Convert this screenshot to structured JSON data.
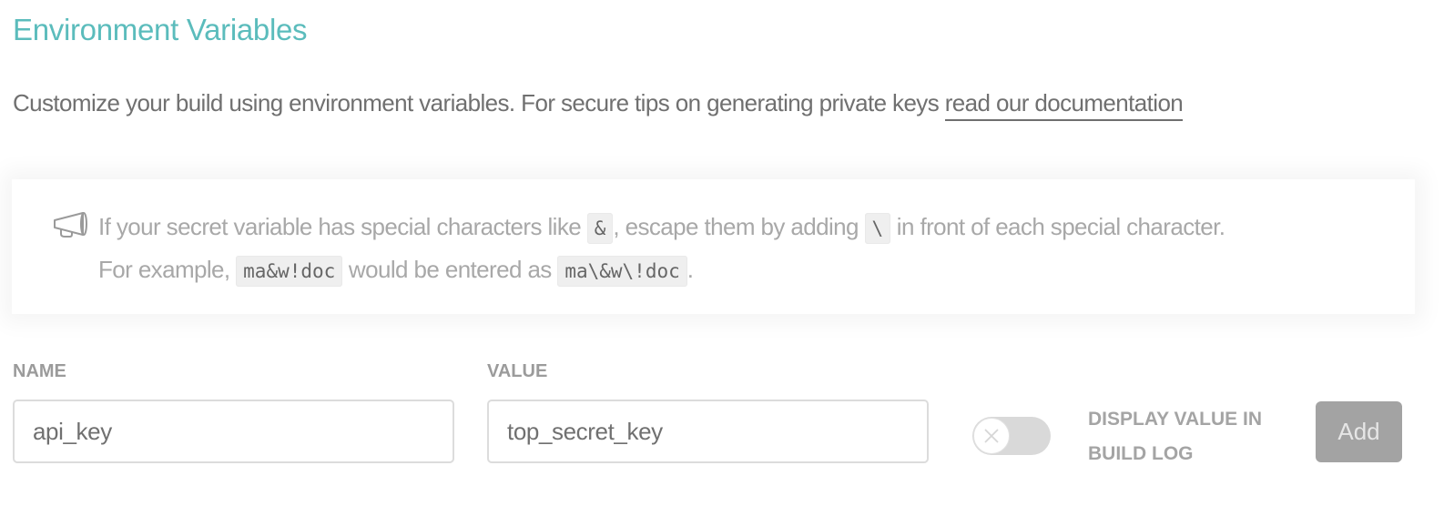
{
  "header": {
    "title": "Environment Variables",
    "intro_text": "Customize your build using environment variables. For secure tips on generating private keys ",
    "doc_link": "read our documentation"
  },
  "notice": {
    "icon": "megaphone-icon",
    "line1_a": "If your secret variable has special characters like ",
    "code_ampersand": "&",
    "line1_b": ", escape them by adding ",
    "code_backslash": "\\",
    "line1_c": " in front of each special character.",
    "line2_a": "For example, ",
    "code_example": "ma&w!doc",
    "line2_b": " would be entered as ",
    "code_escaped": "ma\\&w\\!doc",
    "line2_c": "."
  },
  "form": {
    "name_label": "NAME",
    "name_value": "api_key",
    "value_label": "VALUE",
    "value_value": "top_secret_key",
    "toggle_state": "off",
    "toggle_icon": "x-icon",
    "toggle_label": "DISPLAY VALUE IN BUILD LOG",
    "add_label": "Add"
  }
}
